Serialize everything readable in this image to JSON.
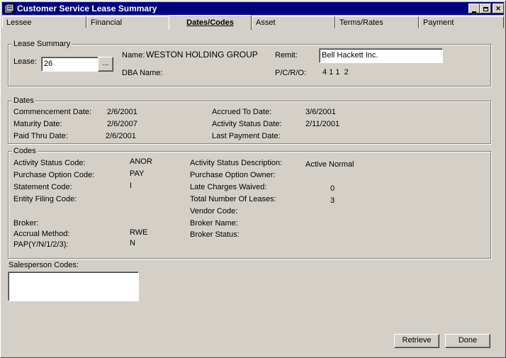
{
  "window": {
    "title": "Customer Service Lease Summary"
  },
  "tabs": [
    {
      "label": "Lessee"
    },
    {
      "label": "Financial"
    },
    {
      "label": "Dates/Codes"
    },
    {
      "label": "Asset"
    },
    {
      "label": "Terms/Rates"
    },
    {
      "label": "Payment"
    }
  ],
  "lease_summary": {
    "group_label": "Lease Summary",
    "lease_label": "Lease:",
    "lease_value": "26",
    "browse_label": "...",
    "name_label": "Name:",
    "name_value": "WESTON HOLDING GROUP",
    "dba_label": "DBA Name:",
    "remit_label": "Remit:",
    "remit_value": "Bell Hackett Inc.",
    "pcro_label": "P/C/R/O:",
    "pcro_value": "4 1 1  2"
  },
  "dates": {
    "group_label": "Dates",
    "commencement_label": "Commencement Date:",
    "commencement_value": "2/6/2001",
    "maturity_label": "Maturity Date:",
    "maturity_value": "2/6/2007",
    "paid_thru_label": "Paid Thru Date:",
    "paid_thru_value": "2/6/2001",
    "accrued_label": "Accrued To Date:",
    "accrued_value": "3/6/2001",
    "activity_status_date_label": "Activity Status Date:",
    "activity_status_date_value": "2/11/2001",
    "last_payment_label": "Last Payment Date:"
  },
  "codes": {
    "group_label": "Codes",
    "activity_status_code_label": "Activity Status Code:",
    "activity_status_code_value": "ANOR",
    "purchase_option_code_label": "Purchase Option Code:",
    "purchase_option_code_value": "PAY",
    "statement_code_label": "Statement Code:",
    "statement_code_value": "I",
    "entity_filing_label": "Entity Filing Code:",
    "broker_label": "Broker:",
    "accrual_method_label": "Accrual Method:",
    "accrual_method_value": "RWE",
    "pap_label": "PAP(Y/N/1/2/3):",
    "pap_value": "N",
    "activity_status_desc_label": "Activity Status Description:",
    "activity_status_desc_value": "Active Normal",
    "purchase_option_owner_label": "Purchase Option Owner:",
    "late_charges_label": "Late Charges Waived:",
    "late_charges_value": "0",
    "total_leases_label": "Total Number Of Leases:",
    "total_leases_value": "3",
    "vendor_code_label": "Vendor Code:",
    "broker_name_label": "Broker Name:",
    "broker_status_label": "Broker Status:"
  },
  "salesperson": {
    "label": "Salesperson Codes:"
  },
  "buttons": {
    "retrieve": "Retrieve",
    "done": "Done"
  }
}
